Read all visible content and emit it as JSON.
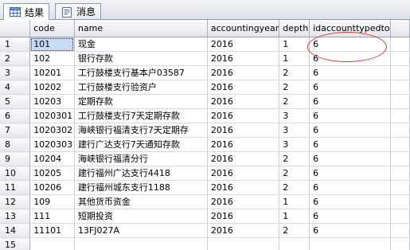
{
  "tabs": [
    {
      "label": "结果",
      "icon": "grid-icon"
    },
    {
      "label": "消息",
      "icon": "message-icon"
    }
  ],
  "columns": [
    "code",
    "name",
    "accountingyear",
    "depth",
    "idaccounttypedto"
  ],
  "rows": [
    {
      "n": "1",
      "code": "101",
      "name": "现金",
      "accountingyear": "2016",
      "depth": "1",
      "idaccounttypedto": "6"
    },
    {
      "n": "2",
      "code": "102",
      "name": "银行存款",
      "accountingyear": "2016",
      "depth": "1",
      "idaccounttypedto": "6"
    },
    {
      "n": "3",
      "code": "10201",
      "name": "工行鼓楼支行基本户03587",
      "accountingyear": "2016",
      "depth": "2",
      "idaccounttypedto": "6"
    },
    {
      "n": "4",
      "code": "10202",
      "name": "工行鼓楼支行验资户",
      "accountingyear": "2016",
      "depth": "2",
      "idaccounttypedto": "6"
    },
    {
      "n": "5",
      "code": "10203",
      "name": "定期存款",
      "accountingyear": "2016",
      "depth": "2",
      "idaccounttypedto": "6"
    },
    {
      "n": "6",
      "code": "1020301",
      "name": "工行鼓楼支行7天定期存款",
      "accountingyear": "2016",
      "depth": "3",
      "idaccounttypedto": "6"
    },
    {
      "n": "7",
      "code": "1020302",
      "name": "海峡银行福清支行7天定期存",
      "accountingyear": "2016",
      "depth": "3",
      "idaccounttypedto": "6"
    },
    {
      "n": "8",
      "code": "1020303",
      "name": "建行广达支行7天通知存款",
      "accountingyear": "2016",
      "depth": "3",
      "idaccounttypedto": "6"
    },
    {
      "n": "9",
      "code": "10204",
      "name": "海峡银行福清分行",
      "accountingyear": "2016",
      "depth": "2",
      "idaccounttypedto": "6"
    },
    {
      "n": "10",
      "code": "10205",
      "name": "建行福州广达支行4418",
      "accountingyear": "2016",
      "depth": "2",
      "idaccounttypedto": "6"
    },
    {
      "n": "11",
      "code": "10206",
      "name": "建行福州城东支行1188",
      "accountingyear": "2016",
      "depth": "2",
      "idaccounttypedto": "6"
    },
    {
      "n": "12",
      "code": "109",
      "name": "其他货币资金",
      "accountingyear": "2016",
      "depth": "1",
      "idaccounttypedto": "6"
    },
    {
      "n": "13",
      "code": "111",
      "name": "短期投资",
      "accountingyear": "2016",
      "depth": "1",
      "idaccounttypedto": "6"
    },
    {
      "n": "14",
      "code": "11101",
      "name": "13FJ027A",
      "accountingyear": "2016",
      "depth": "2",
      "idaccounttypedto": "6"
    },
    {
      "n": "15",
      "code": "",
      "name": "",
      "accountingyear": "",
      "depth": "",
      "idaccounttypedto": ""
    }
  ],
  "colors": {
    "annotation": "#d23a32",
    "selection": "#c8daf4"
  }
}
